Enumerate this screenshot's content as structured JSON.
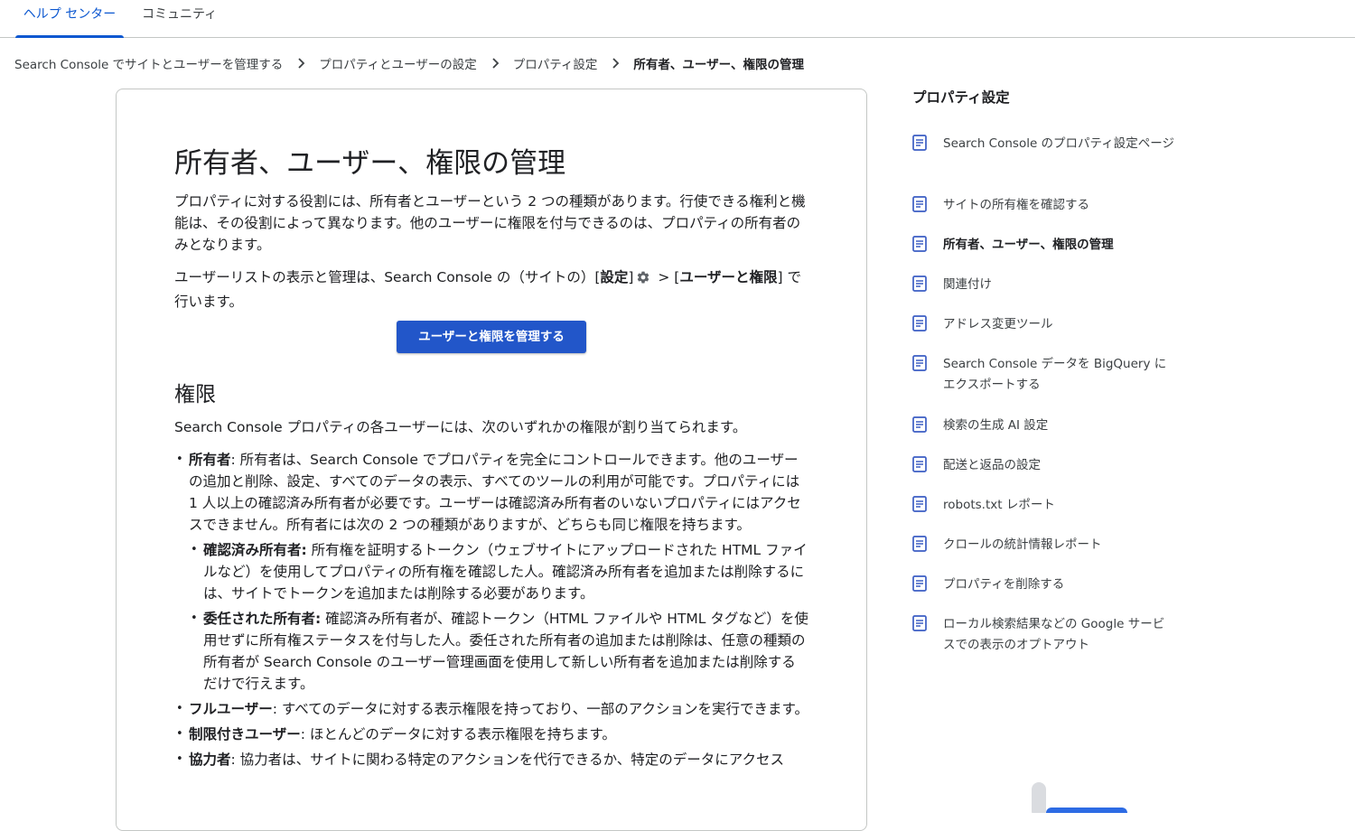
{
  "tabs": [
    {
      "label": "ヘルプ センター",
      "active": true
    },
    {
      "label": "コミュニティ",
      "active": false
    }
  ],
  "breadcrumb": [
    "Search Console でサイトとユーザーを管理する",
    "プロパティとユーザーの設定",
    "プロパティ設定",
    "所有者、ユーザー、権限の管理"
  ],
  "article": {
    "title": "所有者、ユーザー、権限の管理",
    "intro": "プロパティに対する役割には、所有者とユーザーという 2 つの種類があります。行使できる権利と機能は、その役割によって異なります。他のユーザーに権限を付与できるのは、プロパティの所有者のみとなります。",
    "settings_pre": "ユーザーリストの表示と管理は、Search Console の（サイトの）[",
    "settings_bold1": "設定",
    "settings_mid1": "]",
    "settings_mid2": " > [",
    "settings_bold2": "ユーザーと権限",
    "settings_post": "] で行います。",
    "manage_button": "ユーザーと権限を管理する",
    "permissions_heading": "権限",
    "permissions_intro": "Search Console プロパティの各ユーザーには、次のいずれかの権限が割り当てられます。",
    "permissions": [
      {
        "term": "所有者",
        "text": ": 所有者は、Search Console でプロパティを完全にコントロールできます。他のユーザーの追加と削除、設定、すべてのデータの表示、すべてのツールの利用が可能です。プロパティには 1 人以上の確認済み所有者が必要です。ユーザーは確認済み所有者のいないプロパティにはアクセスできません。所有者には次の 2 つの種類がありますが、どちらも同じ権限を持ちます。",
        "sub": [
          {
            "term": "確認済み所有者:",
            "text": " 所有権を証明するトークン（ウェブサイトにアップロードされた HTML ファイルなど）を使用してプロパティの所有権を確認した人。確認済み所有者を追加または削除するには、サイトでトークンを追加または削除する必要があります。"
          },
          {
            "term": "委任された所有者:",
            "text": " 確認済み所有者が、確認トークン（HTML ファイルや HTML タグなど）を使用せずに所有権ステータスを付与した人。委任された所有者の追加または削除は、任意の種類の所有者が Search Console のユーザー管理画面を使用して新しい所有者を追加または削除するだけで行えます。"
          }
        ]
      },
      {
        "term": "フルユーザー",
        "text": ": すべてのデータに対する表示権限を持っており、一部のアクションを実行できます。"
      },
      {
        "term": "制限付きユーザー",
        "text": ": ほとんどのデータに対する表示権限を持ちます。"
      },
      {
        "term": "協力者",
        "text": ": 協力者は、サイトに関わる特定のアクションを代行できるか、特定のデータにアクセス"
      }
    ]
  },
  "sidebar": {
    "title": "プロパティ設定",
    "items": [
      {
        "label": "Search Console のプロパティ設定ページ"
      },
      {
        "label": "サイトの所有権を確認する"
      },
      {
        "label": "所有者、ユーザー、権限の管理",
        "current": true
      },
      {
        "label": "関連付け"
      },
      {
        "label": "アドレス変更ツール"
      },
      {
        "label": "Search Console データを BigQuery にエクスポートする"
      },
      {
        "label": "検索の生成 AI 設定"
      },
      {
        "label": "配送と返品の設定"
      },
      {
        "label": "robots.txt レポート"
      },
      {
        "label": "クロールの統計情報レポート"
      },
      {
        "label": "プロパティを削除する"
      },
      {
        "label": "ローカル検索結果などの Google サービスでの表示のオプトアウト"
      }
    ]
  },
  "icons": {
    "sidebar_item": "article-icon",
    "settings": "gear-icon",
    "breadcrumb_separator": "chevron-right-icon"
  },
  "colors": {
    "accent": "#0b57d0",
    "button": "#2256c9",
    "sidebar_icon": "#3b5dc4"
  }
}
